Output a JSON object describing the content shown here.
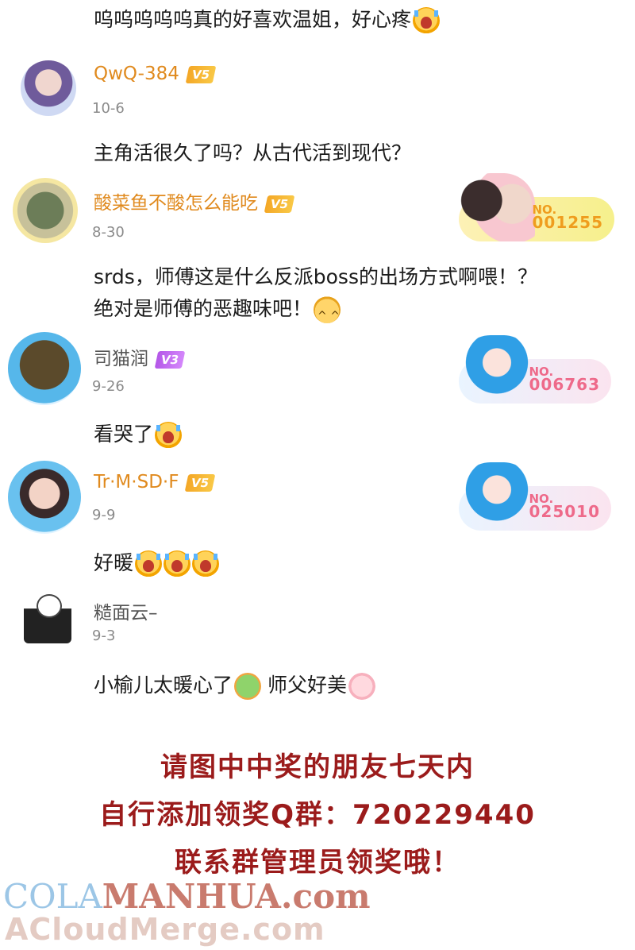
{
  "comments": [
    {
      "text": "呜呜呜呜呜真的好喜欢温姐，好心疼",
      "emoji": [
        "crying-face"
      ]
    },
    {
      "user": "QwQ-384",
      "level": "V5",
      "date": "10-6",
      "text": "主角活很久了吗？从古代活到现代？"
    },
    {
      "user": "酸菜鱼不酸怎么能吃",
      "level": "V5",
      "date": "8-30",
      "fan_no_label": "NO.",
      "fan_no": "001255",
      "text_line1": "srds，师傅这是什么反派boss的出场方式啊喂！？",
      "text_line2": "绝对是师傅的恶趣味吧！"
    },
    {
      "user": "司猫润",
      "level": "V3",
      "date": "9-26",
      "fan_no_label": "NO.",
      "fan_no": "006763",
      "text": "看哭了"
    },
    {
      "user": "Tr·M·SD·F",
      "level": "V5",
      "date": "9-9",
      "fan_no_label": "NO.",
      "fan_no": "025010",
      "text": "好暖"
    },
    {
      "user": "糙面云–",
      "date": "9-3",
      "text_a": "小榆儿太暖心了",
      "text_b": " 师父好美"
    }
  ],
  "notice": {
    "line1": "请图中中奖的朋友七天内",
    "line2": "自行添加领奖Q群：720229440",
    "line3": "联系群管理员领奖哦！"
  },
  "watermark": {
    "part1": "COLA",
    "part2": "MANHUA.com",
    "line2": "ACloudMerge.com"
  },
  "colors": {
    "username_gold": "#e08a1e",
    "notice_red": "#9b1b1b"
  }
}
